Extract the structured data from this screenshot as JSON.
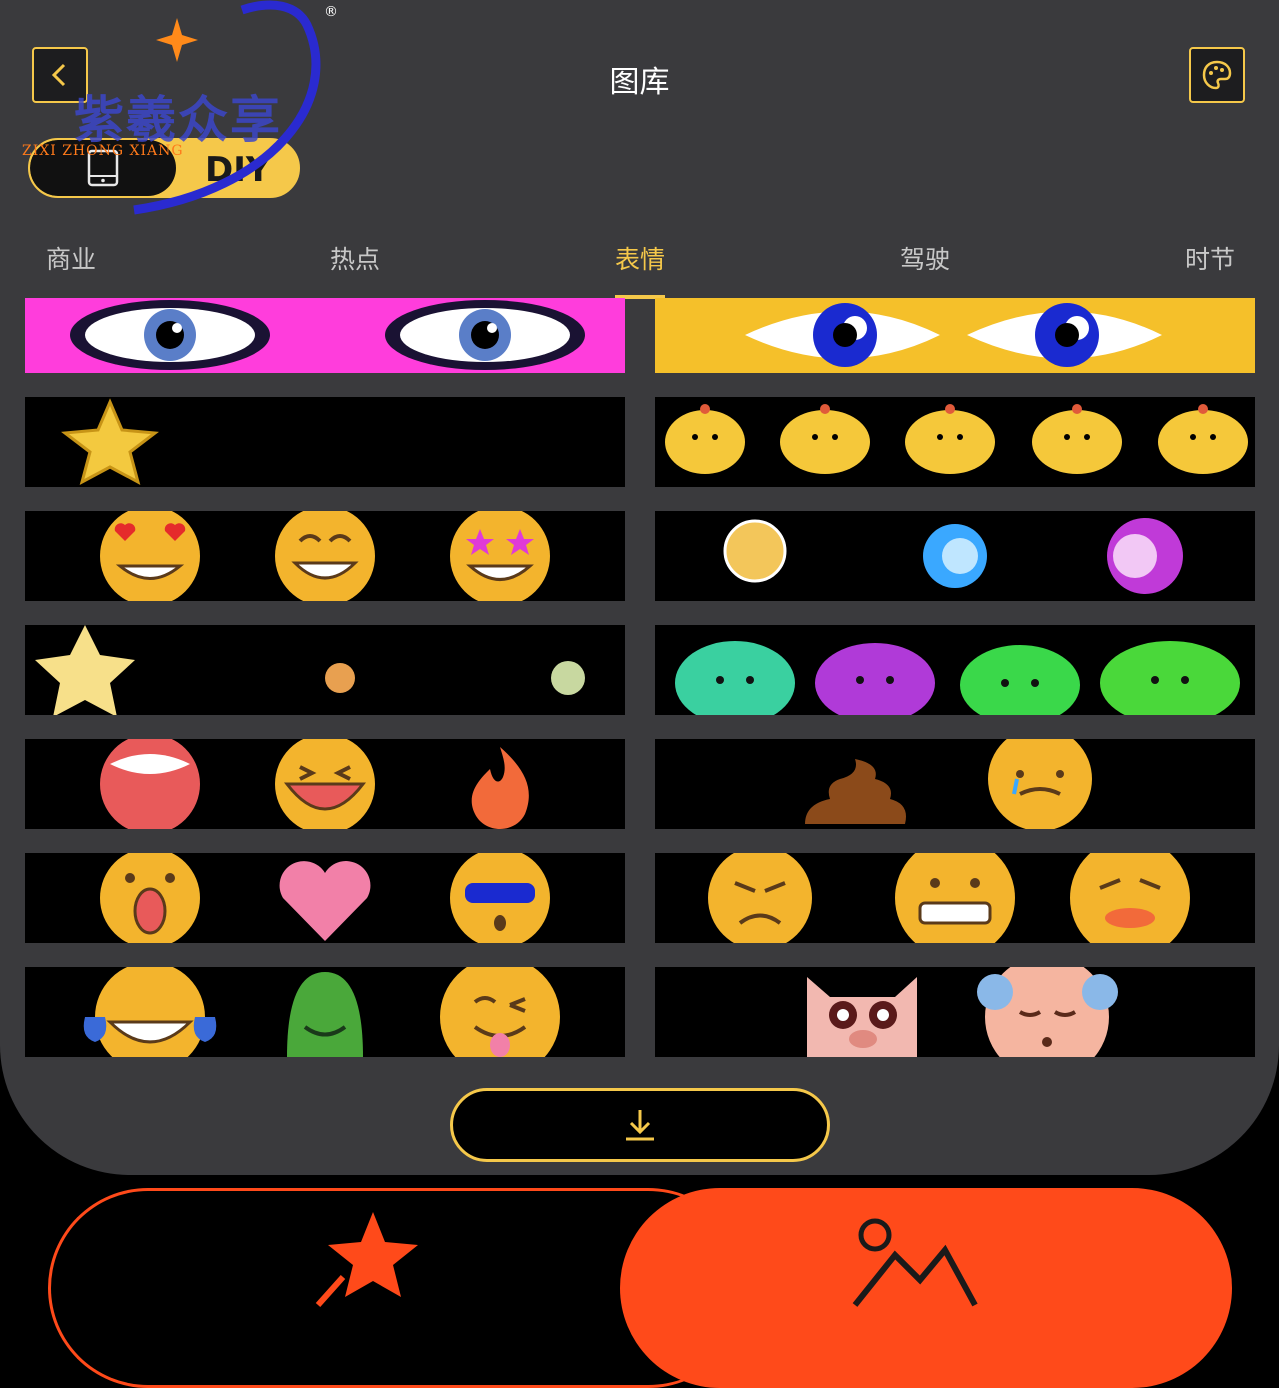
{
  "header": {
    "title": "图库",
    "back_icon": "back-icon",
    "palette_icon": "palette-icon"
  },
  "mode_toggle": {
    "left_icon": "phone-icon",
    "right_label": "DIY"
  },
  "tabs": [
    {
      "label": "商业",
      "active": false
    },
    {
      "label": "热点",
      "active": false
    },
    {
      "label": "表情",
      "active": true
    },
    {
      "label": "驾驶",
      "active": false
    },
    {
      "label": "时节",
      "active": false
    }
  ],
  "gallery": [
    [
      "eyes-magenta",
      "eyes-yellow"
    ],
    [
      "star",
      "chicks"
    ],
    [
      "heart-eyes-grin-star-eyes",
      "fireball-effects"
    ],
    [
      "star-face-dots",
      "monsters"
    ],
    [
      "laughing-fire",
      "poop-crying"
    ],
    [
      "shocked-heart-face",
      "angry-grimace-wince"
    ],
    [
      "tears-of-joy-green-wink",
      "pig-grandpa"
    ]
  ],
  "download": {
    "icon": "download-icon"
  },
  "bottom_nav": {
    "left_icon": "star-wand-icon",
    "right_icon": "image-icon"
  },
  "watermark": {
    "text": "紫羲众享",
    "subtext": "ZIXI ZHONG XIANG",
    "reg": "®"
  },
  "colors": {
    "accent": "#f5c84a",
    "orange": "#ff4a1a",
    "panel": "#3a3a3d"
  }
}
